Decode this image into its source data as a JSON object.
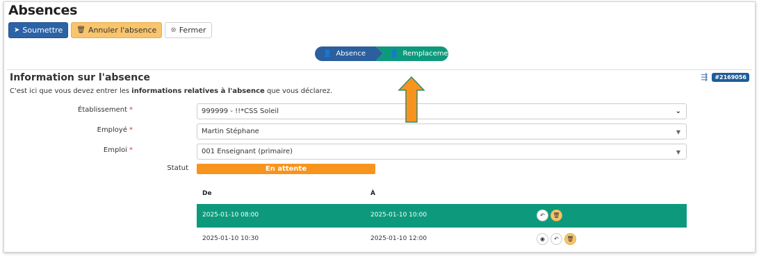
{
  "page": {
    "title": "Absences"
  },
  "toolbar": {
    "submit_label": "Soumettre",
    "cancel_label": "Annuler l'absence",
    "close_label": "Fermer"
  },
  "steps": [
    {
      "label": "Absence",
      "color": "#2b5f9e"
    },
    {
      "label": "Remplacement",
      "color": "#0d9a7c"
    }
  ],
  "section": {
    "title": "Information sur l'absence",
    "intro_prefix": "C'est ici que vous devez entrer les ",
    "intro_bold": "informations relatives à l'absence",
    "intro_suffix": " que vous déclarez.",
    "reference": "#2169056"
  },
  "form": {
    "etablissement": {
      "label": "Établissement",
      "value": "999999 - !!*CSS Soleil"
    },
    "employe": {
      "label": "Employé",
      "value": "Martin Stéphane"
    },
    "emploi": {
      "label": "Emploi",
      "value": "001 Enseignant (primaire)"
    },
    "statut": {
      "label": "Statut",
      "value": "En attente",
      "color": "#f7941d"
    }
  },
  "table": {
    "headers": {
      "from": "De",
      "to": "À"
    },
    "rows": [
      {
        "from": "2025-01-10 08:00",
        "to": "2025-01-10 10:00",
        "selected": true
      },
      {
        "from": "2025-01-10 10:30",
        "to": "2025-01-10 12:00",
        "selected": false
      }
    ]
  },
  "colors": {
    "primary": "#2c63a7",
    "success": "#0d9a7c",
    "warning": "#f8c46c",
    "status": "#f7941d"
  }
}
